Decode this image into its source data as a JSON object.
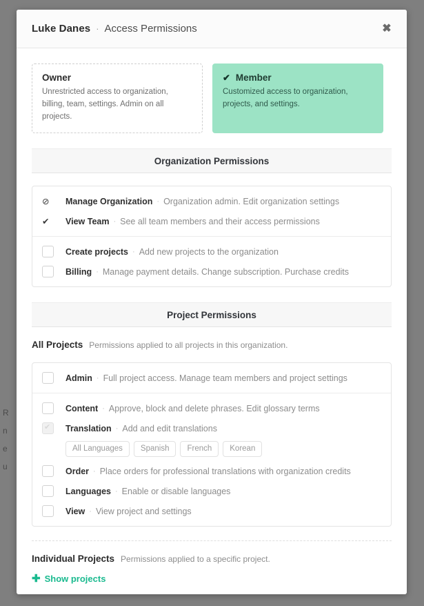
{
  "background": {
    "clipped_lines": [
      "R",
      "n",
      "e",
      "u"
    ]
  },
  "modal": {
    "header": {
      "user_name": "Luke Danes",
      "separator": "·",
      "page_title": "Access Permissions",
      "close_icon": "✖"
    },
    "roles": [
      {
        "name": "Owner",
        "description": "Unrestricted access to organization, billing, team, settings. Admin on all projects.",
        "selected": false,
        "check_icon": ""
      },
      {
        "name": "Member",
        "description": "Customized access to organization, projects, and settings.",
        "selected": true,
        "check_icon": "✔"
      }
    ],
    "organization_section": {
      "band_title": "Organization Permissions",
      "static_rows": [
        {
          "icon": "⊘",
          "icon_name": "prohibited-icon",
          "label": "Manage Organization",
          "separator": "·",
          "description": "Organization admin. Edit organization settings"
        },
        {
          "icon": "✔",
          "icon_name": "check-icon",
          "label": "View Team",
          "separator": "·",
          "description": "See all team members and their access permissions"
        }
      ],
      "checkbox_rows": [
        {
          "label": "Create projects",
          "separator": "·",
          "description": "Add new projects to the organization",
          "checked": false
        },
        {
          "label": "Billing",
          "separator": "·",
          "description": "Manage payment details. Change subscription. Purchase credits",
          "checked": false
        }
      ]
    },
    "project_section": {
      "band_title": "Project Permissions",
      "all_projects": {
        "title": "All Projects",
        "description": "Permissions applied to all projects in this organization."
      },
      "admin_row": {
        "label": "Admin",
        "separator": "·",
        "description": "Full project access. Manage team members and project settings",
        "checked": false
      },
      "rows": [
        {
          "label": "Content",
          "separator": "·",
          "description": "Approve, block and delete phrases. Edit glossary terms",
          "checked": false,
          "muted": false
        },
        {
          "label": "Translation",
          "separator": "·",
          "description": "Add and edit translations",
          "checked": true,
          "muted": true
        }
      ],
      "language_pills": [
        "All Languages",
        "Spanish",
        "French",
        "Korean"
      ],
      "rows_after": [
        {
          "label": "Order",
          "separator": "·",
          "description": "Place orders for professional translations with organization credits",
          "checked": false,
          "muted": false
        },
        {
          "label": "Languages",
          "separator": "·",
          "description": "Enable or disable languages",
          "checked": false,
          "muted": false
        },
        {
          "label": "View",
          "separator": "·",
          "description": "View project and settings",
          "checked": false,
          "muted": false
        }
      ]
    },
    "individual_projects": {
      "title": "Individual Projects",
      "description": "Permissions applied to a specific project.",
      "show_link_plus": "✚",
      "show_link_label": "Show projects"
    }
  },
  "colors": {
    "accent_green": "#1aba8f",
    "member_card_bg": "#9ce3c5",
    "overlay": "#7f7f7f",
    "band_bg": "#f7f7f7"
  }
}
